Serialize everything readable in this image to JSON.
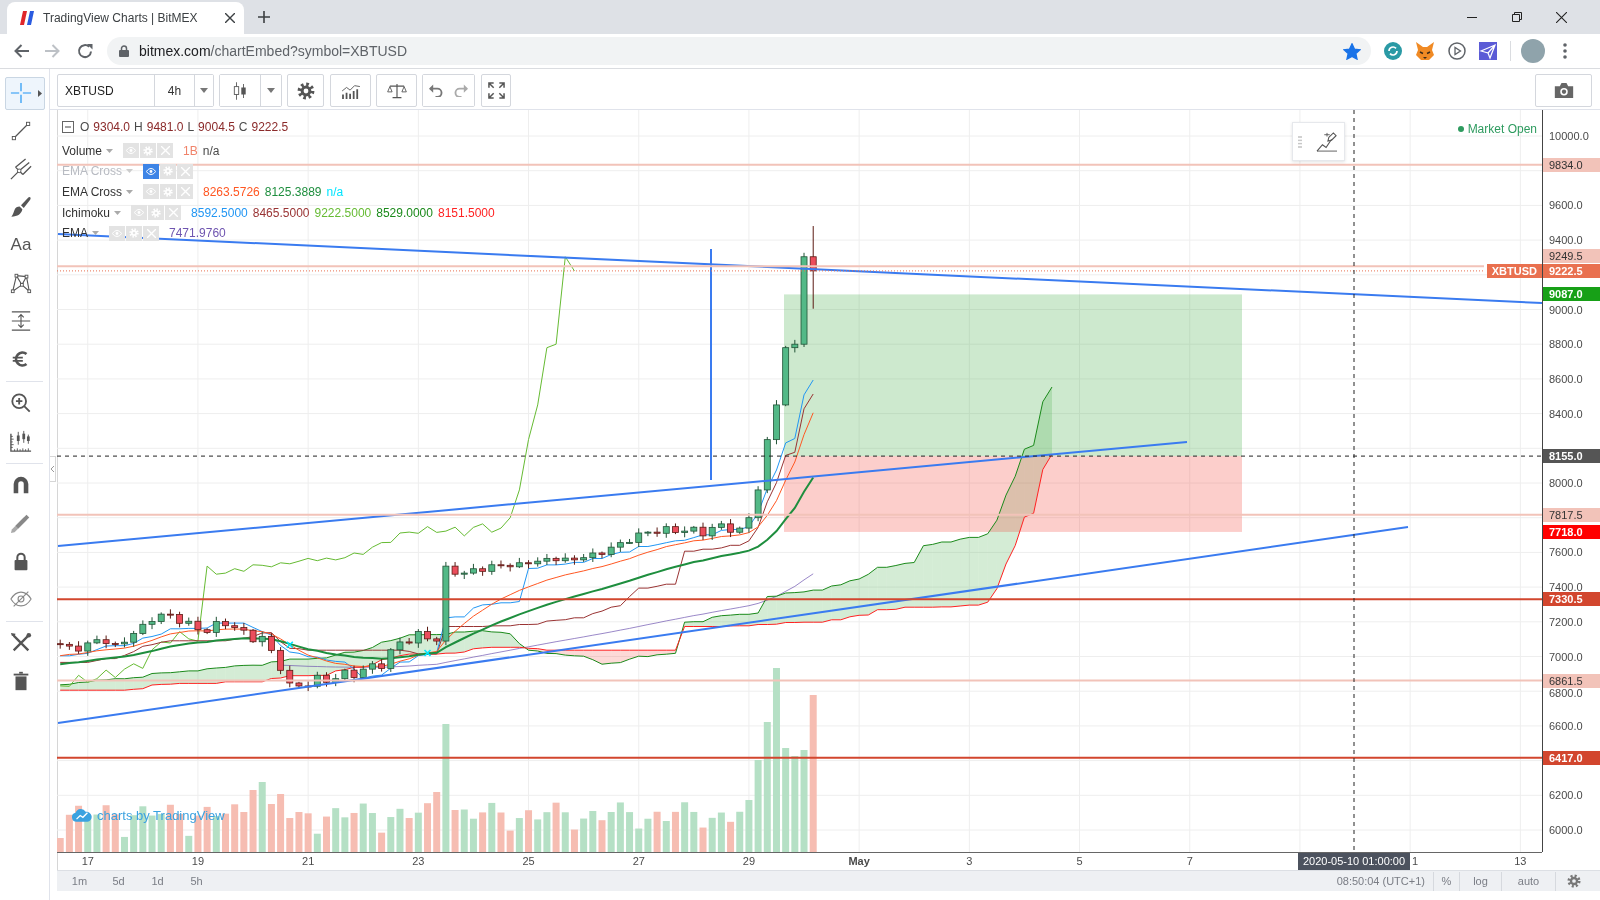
{
  "browser": {
    "tab": {
      "title": "TradingView Charts | BitMEX"
    },
    "forward_disabled": true,
    "address": {
      "host": "bitmex.com",
      "path": "/chartEmbed?symbol=XBTUSD",
      "bookmarked": true
    }
  },
  "header_toolbar": {
    "symbol": "XBTUSD",
    "interval": "4h"
  },
  "drawing_toolbar": {
    "groups": [
      {
        "tools": [
          {
            "selected": true
          },
          {
            "selected": false
          },
          {
            "selected": false
          },
          {
            "selected": false
          },
          {
            "label": "Aa",
            "selected": false
          },
          {
            "selected": false
          },
          {
            "selected": false
          },
          {
            "selected": false
          }
        ]
      },
      {
        "tools": [
          {
            "selected": false
          },
          {
            "selected": false
          }
        ]
      },
      {
        "tools": [
          {
            "selected": false
          },
          {
            "selected": false
          },
          {
            "selected": false
          },
          {
            "selected": false
          }
        ]
      },
      {
        "tools": [
          {
            "selected": false
          },
          {
            "selected": false
          }
        ]
      }
    ]
  },
  "legend": {
    "expanded": true,
    "ohlc": [
      {
        "label": "O",
        "value": "9304.0"
      },
      {
        "label": "H",
        "value": "9481.0"
      },
      {
        "label": "L",
        "value": "9004.5"
      },
      {
        "label": "C",
        "value": "9222.5"
      }
    ],
    "studies": [
      {
        "name": "Volume",
        "hidden": false,
        "values": [
          {
            "text": "1B",
            "color": "#f0836a"
          },
          {
            "text": "n/a",
            "color": "#4a4a4a"
          }
        ]
      },
      {
        "name": "EMA Cross",
        "hidden": true
      },
      {
        "name": "EMA Cross",
        "hidden": false,
        "values": [
          {
            "text": "8263.5726",
            "color": "#ff5722"
          },
          {
            "text": "8125.3889",
            "color": "#1e8e3e"
          },
          {
            "text": "n/a",
            "color": "#00e5ff"
          }
        ]
      },
      {
        "name": "Ichimoku",
        "hidden": false,
        "values": [
          {
            "text": "8592.5000",
            "color": "#2196f3"
          },
          {
            "text": "8465.5000",
            "color": "#993333"
          },
          {
            "text": "9222.5000",
            "color": "#66bb33"
          },
          {
            "text": "8529.0000",
            "color": "#1b8a1b"
          },
          {
            "text": "8151.5000",
            "color": "#ff2222"
          }
        ]
      },
      {
        "name": "EMA",
        "hidden": false,
        "values": [
          {
            "text": "7471.9760",
            "color": "#6f55b0"
          }
        ]
      }
    ]
  },
  "market_status": {
    "label": "Market Open",
    "open": true
  },
  "price_axis": {
    "ticks": [
      "10000.0",
      "9600.0",
      "9400.0",
      "9000.0",
      "8800.0",
      "8600.0",
      "8400.0",
      "8000.0",
      "7600.0",
      "7400.0",
      "7200.0",
      "7000.0",
      "6800.0",
      "6600.0",
      "6200.0",
      "6000.0"
    ],
    "labels": [
      {
        "value": "9834.0",
        "kind": "level",
        "color": "#f2c3b9"
      },
      {
        "value": "9249.5",
        "kind": "level",
        "color": "#f2c3b9"
      },
      {
        "value": "9222.5",
        "kind": "last",
        "symbol": "XBTUSD",
        "color": "#e9704f"
      },
      {
        "value": "9087.0",
        "kind": "target",
        "color": "#17a017"
      },
      {
        "value": "8155.0",
        "kind": "crosshair",
        "color": "#555555"
      },
      {
        "value": "7817.5",
        "kind": "level",
        "color": "#f2c3b9"
      },
      {
        "value": "7718.0",
        "kind": "stop",
        "color": "#ff0000"
      },
      {
        "value": "7330.5",
        "kind": "level",
        "color": "#d2462e"
      },
      {
        "value": "6861.5",
        "kind": "level",
        "color": "#f2c3b9"
      },
      {
        "value": "6417.0",
        "kind": "level",
        "color": "#d2462e"
      }
    ]
  },
  "branding": {
    "label": "charts by TradingView"
  },
  "time_axis": {
    "labels": [
      {
        "text": "17",
        "kind": "day"
      },
      {
        "text": "19",
        "kind": "day"
      },
      {
        "text": "21",
        "kind": "day"
      },
      {
        "text": "23",
        "kind": "day"
      },
      {
        "text": "25",
        "kind": "day"
      },
      {
        "text": "27",
        "kind": "day"
      },
      {
        "text": "29",
        "kind": "day"
      },
      {
        "text": "May",
        "kind": "month"
      },
      {
        "text": "3",
        "kind": "day"
      },
      {
        "text": "5",
        "kind": "day"
      },
      {
        "text": "7",
        "kind": "day"
      },
      {
        "text": "1",
        "kind": "day"
      },
      {
        "text": "13",
        "kind": "day"
      }
    ],
    "crosshair": "2020-05-10 01:00:00"
  },
  "bottom_bar": {
    "ranges": [
      "1m",
      "5d",
      "1d",
      "5h"
    ],
    "clock": "08:50:04 (UTC+1)",
    "toggles": [
      {
        "label": "%",
        "on": false
      },
      {
        "label": "log",
        "on": false
      },
      {
        "label": "auto",
        "on": false
      }
    ]
  }
}
